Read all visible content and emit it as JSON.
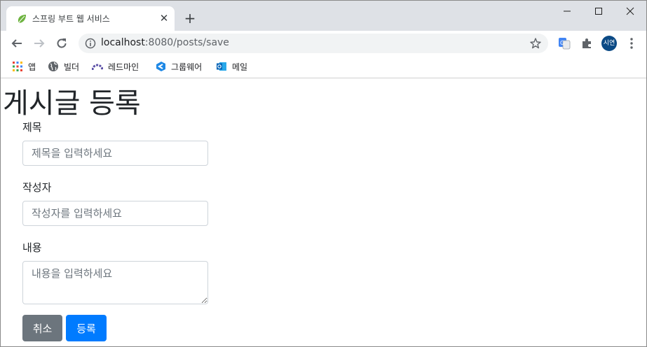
{
  "browser": {
    "tab_title": "스프링 부트 웹 서비스",
    "url_host": "localhost",
    "url_rest": ":8080/posts/save",
    "profile_label": "시연",
    "bookmarks": [
      {
        "label": "앱",
        "icon": "apps-grid-icon"
      },
      {
        "label": "빌더",
        "icon": "globe-icon"
      },
      {
        "label": "레드마인",
        "icon": "redmine-icon"
      },
      {
        "label": "그룹웨어",
        "icon": "groupware-icon"
      },
      {
        "label": "메일",
        "icon": "outlook-icon"
      }
    ]
  },
  "page": {
    "heading": "게시글 등록",
    "title_label": "제목",
    "title_placeholder": "제목을 입력하세요",
    "author_label": "작성자",
    "author_placeholder": "작성자를 입력하세요",
    "content_label": "내용",
    "content_placeholder": "내용을 입력하세요",
    "cancel_label": "취소",
    "save_label": "등록"
  },
  "colors": {
    "tabstrip_bg": "#dee1e6",
    "btn_secondary": "#6c757d",
    "btn_primary": "#007bff",
    "profile_avatar": "#0b4a85"
  }
}
